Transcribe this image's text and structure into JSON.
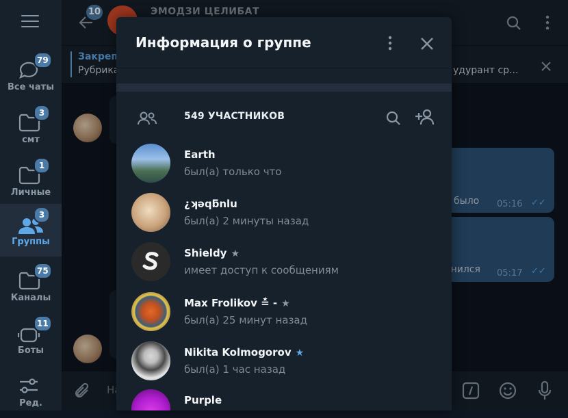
{
  "folders": [
    {
      "label": "Все чаты",
      "badge": "79",
      "icon": "chat-bubbles-icon"
    },
    {
      "label": "смт",
      "badge": "3",
      "icon": "folder-icon"
    },
    {
      "label": "Личные",
      "badge": "1",
      "icon": "folder-icon"
    },
    {
      "label": "Группы",
      "badge": "3",
      "icon": "group-icon"
    },
    {
      "label": "Каналы",
      "badge": "75",
      "icon": "folder-icon"
    },
    {
      "label": "Боты",
      "badge": "11",
      "icon": "bot-icon"
    },
    {
      "label": "Ред.",
      "badge": "",
      "icon": "sliders-icon"
    }
  ],
  "chat": {
    "title": "ЭМОДЗИ ЦЕЛИБАТ",
    "back_badge": "10",
    "pinned_title": "Закреп",
    "pinned_text": "Рубрика",
    "pinned_text_right": "удурант ср...",
    "messages": [
      {
        "text": "а было",
        "time": "05:16"
      },
      {
        "text": "анился",
        "time": "05:17"
      }
    ],
    "composer_placeholder": "На"
  },
  "modal": {
    "title": "Информация о группе",
    "members_count": "549 УЧАСТНИКОВ",
    "members": [
      {
        "name": "Earth",
        "status": "был(а) только что",
        "star": "",
        "avatar": "landscape"
      },
      {
        "name": "¿ʞǝqƃnlu",
        "status": "был(а) 2 минуты назад",
        "star": "",
        "avatar": "cat"
      },
      {
        "name": "Shieldy",
        "status": "имеет доступ к сообщениям",
        "star": "★",
        "avatar": "s-logo"
      },
      {
        "name": "Max Frolikov ≛ -",
        "status": "был(а) 25 минут назад",
        "star": "★",
        "avatar": "fox"
      },
      {
        "name": "Nikita Kolmogorov",
        "status": "был(а) 1 час назад",
        "star": "★",
        "avatar": "portrait"
      },
      {
        "name": "Purple",
        "status": "",
        "star": "",
        "avatar": "purple"
      }
    ],
    "star_colors": [
      "",
      "",
      "#8e9aa6",
      "#8e9aa6",
      "#5fa8e8",
      ""
    ]
  },
  "colors": {
    "accent": "#5fa8e8",
    "panel": "#17212b",
    "background": "#0e1621",
    "badge": "#4a7aa5",
    "outgoing_bubble": "#2b5278"
  }
}
